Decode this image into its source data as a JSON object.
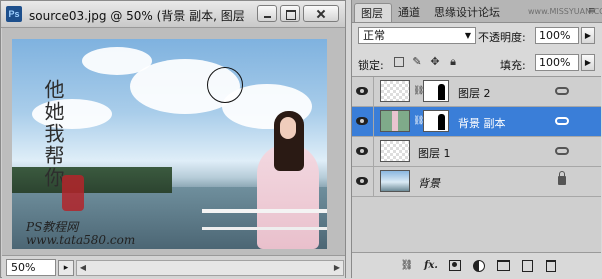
{
  "document": {
    "app_icon": "Ps",
    "title": "source03.jpg @ 50% (背景 副本, 图层",
    "zoom": "50%",
    "image": {
      "calligraphy": "他她我帮你",
      "watermark_line1": "PS教程网",
      "watermark_line2": "www.tata580.com"
    }
  },
  "layers_panel": {
    "tabs": [
      "图层",
      "通道",
      "思缘设计论坛"
    ],
    "forum_url": "www.MISSYUAN.COM",
    "blend_mode": "正常",
    "opacity_label": "不透明度:",
    "opacity_value": "100%",
    "lock_label": "锁定:",
    "fill_label": "填充:",
    "fill_value": "100%",
    "layers": [
      {
        "name": "图层 2",
        "visible": true,
        "has_mask": true,
        "selected": false,
        "linked": true
      },
      {
        "name": "背景 副本",
        "visible": true,
        "has_mask": true,
        "selected": true,
        "linked": true
      },
      {
        "name": "图层 1",
        "visible": true,
        "has_mask": false,
        "selected": false,
        "linked": true
      },
      {
        "name": "背景",
        "visible": true,
        "has_mask": false,
        "selected": false,
        "locked": true
      }
    ],
    "bottom_icons": [
      "link-layers-icon",
      "fx-icon",
      "add-mask-icon",
      "adjustment-layer-icon",
      "new-group-icon",
      "new-layer-icon",
      "trash-icon"
    ]
  },
  "colors": {
    "selection": "#3a7ed8"
  }
}
